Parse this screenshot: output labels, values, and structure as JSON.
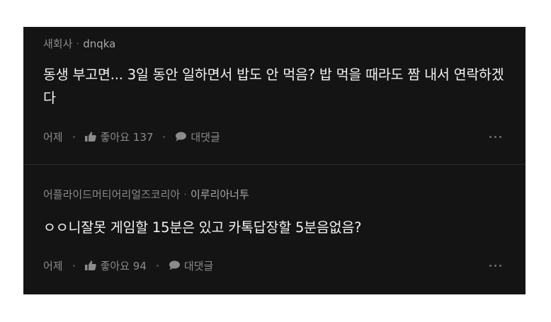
{
  "comments": [
    {
      "source": "새회사",
      "author": "dnqka",
      "text": "동생 부고면... 3일 동안 일하면서 밥도 안 먹음? 밥 먹을 때라도 짬 내서 연락하겠다",
      "time": "어제",
      "like_label": "좋아요 137",
      "reply_label": "대댓글"
    },
    {
      "source": "어플라이드머티어리얼즈코리아",
      "author": "이루리아너투",
      "text": "ㅇㅇ니잘못 게임할 15분은 있고 카톡답장할 5분음없음?",
      "time": "어제",
      "like_label": "좋아요 94",
      "reply_label": "대댓글"
    }
  ],
  "meta_separator": "·",
  "icons": {
    "like": "thumbs-up-icon",
    "reply": "speech-bubble-icon",
    "more": "more-dots-icon"
  },
  "colors": {
    "panel_background": "#141414",
    "body_text": "#f2f2f2",
    "secondary_text": "#8b8b8b"
  }
}
